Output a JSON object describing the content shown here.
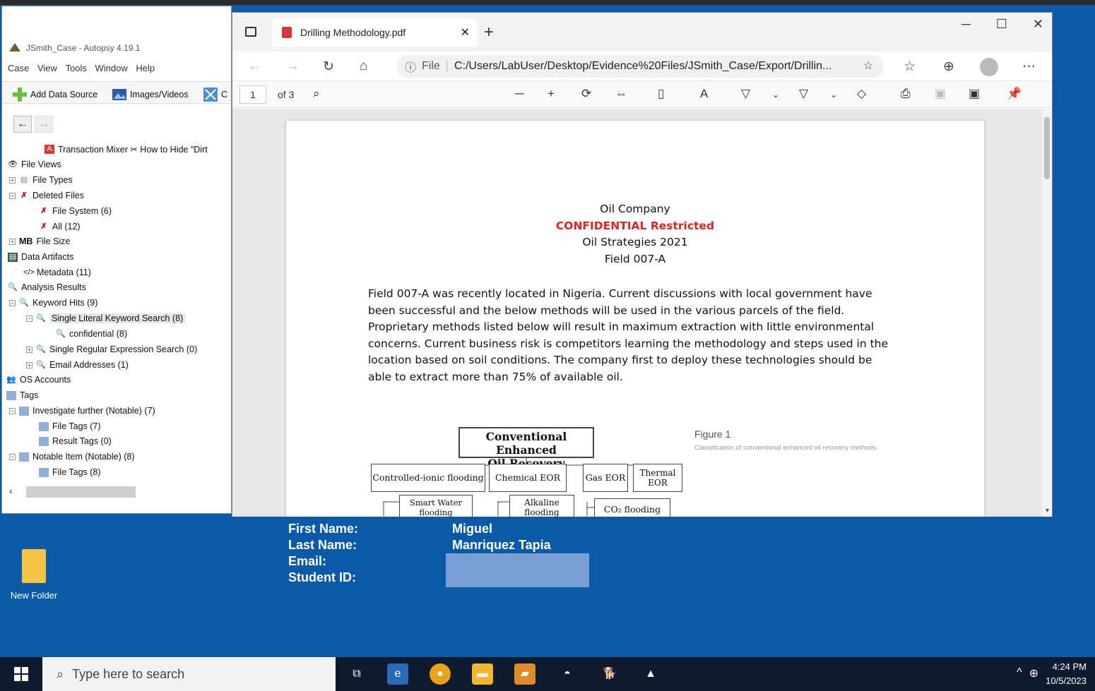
{
  "autopsy": {
    "title": "JSmith_Case - Autopsy 4.19.1",
    "menu": [
      "Case",
      "View",
      "Tools",
      "Window",
      "Help"
    ],
    "toolbar": {
      "add_data_source": "Add Data Source",
      "images_videos": "Images/Videos",
      "cut": "C"
    },
    "tree": {
      "transaction": "Transaction Mixer ✂ How to Hide \"Dirt",
      "file_views": "File Views",
      "file_types": "File Types",
      "deleted_files": "Deleted Files",
      "file_system": "File System (6)",
      "all": "All (12)",
      "file_size_mb": "MB",
      "file_size": "File Size",
      "data_artifacts": "Data Artifacts",
      "metadata": "Metadata (11)",
      "analysis_results": "Analysis Results",
      "keyword_hits": "Keyword Hits (9)",
      "single_literal": "Single Literal Keyword Search (8)",
      "confidential": "confidential (8)",
      "single_regex": "Single Regular Expression Search (0)",
      "email_addresses": "Email Addresses (1)",
      "os_accounts": "OS Accounts",
      "tags": "Tags",
      "investigate": "Investigate further  (Notable) (7)",
      "file_tags_7": "File Tags (7)",
      "result_tags": "Result Tags (0)",
      "notable_item": "Notable Item (Notable) (8)",
      "file_tags_8": "File Tags (8)"
    }
  },
  "edge": {
    "tab_title": "Drilling Methodology.pdf",
    "url_prefix": "File",
    "url": "C:/Users/LabUser/Desktop/Evidence%20Files/JSmith_Case/Export/Drillin...",
    "page_number": "1",
    "page_of": "of 3"
  },
  "document": {
    "company": "Oil Company",
    "confidential": "CONFIDENTIAL Restricted",
    "strategies": "Oil Strategies 2021",
    "field": "Field 007-A",
    "lines": [
      "Field 007-A was recently located in Nigeria.  Current discussions with local government have",
      "been successful and the below methods will be used in the various parcels of the field.",
      "Proprietary methods listed below will result in maximum extraction with little environmental",
      "concerns.   Current business risk is competitors learning the methodology and steps used in the",
      "location based on soil conditions.  The company first to deploy these technologies should be",
      "able to extract more than 75% of available oil."
    ],
    "figure": {
      "root_line1": "Conventional Enhanced",
      "root_line2": "Oil Recovery Methods",
      "controlled": "Controlled-ionic flooding",
      "chemical": "Chemical EOR",
      "gas": "Gas EOR",
      "thermal_line1": "Thermal",
      "thermal_line2": "EOR",
      "smart_line1": "Smart Water",
      "smart_line2": "flooding",
      "alkaline_line1": "Alkaline",
      "alkaline_line2": "flooding",
      "co2": "CO₂ flooding",
      "figure_title": "Figure 1",
      "figure_caption": "Classification of conventional enhanced oil recovery methods."
    }
  },
  "desktop": {
    "folder_label": "New Folder",
    "first_name_label": "First Name:",
    "last_name_label": "Last Name:",
    "email_label": "Email:",
    "student_id_label": "Student ID:",
    "first_name": "Miguel",
    "last_name": "Manriquez Tapia"
  },
  "taskbar": {
    "search_placeholder": "Type here to search",
    "time": "4:24 PM",
    "date": "10/5/2023"
  }
}
